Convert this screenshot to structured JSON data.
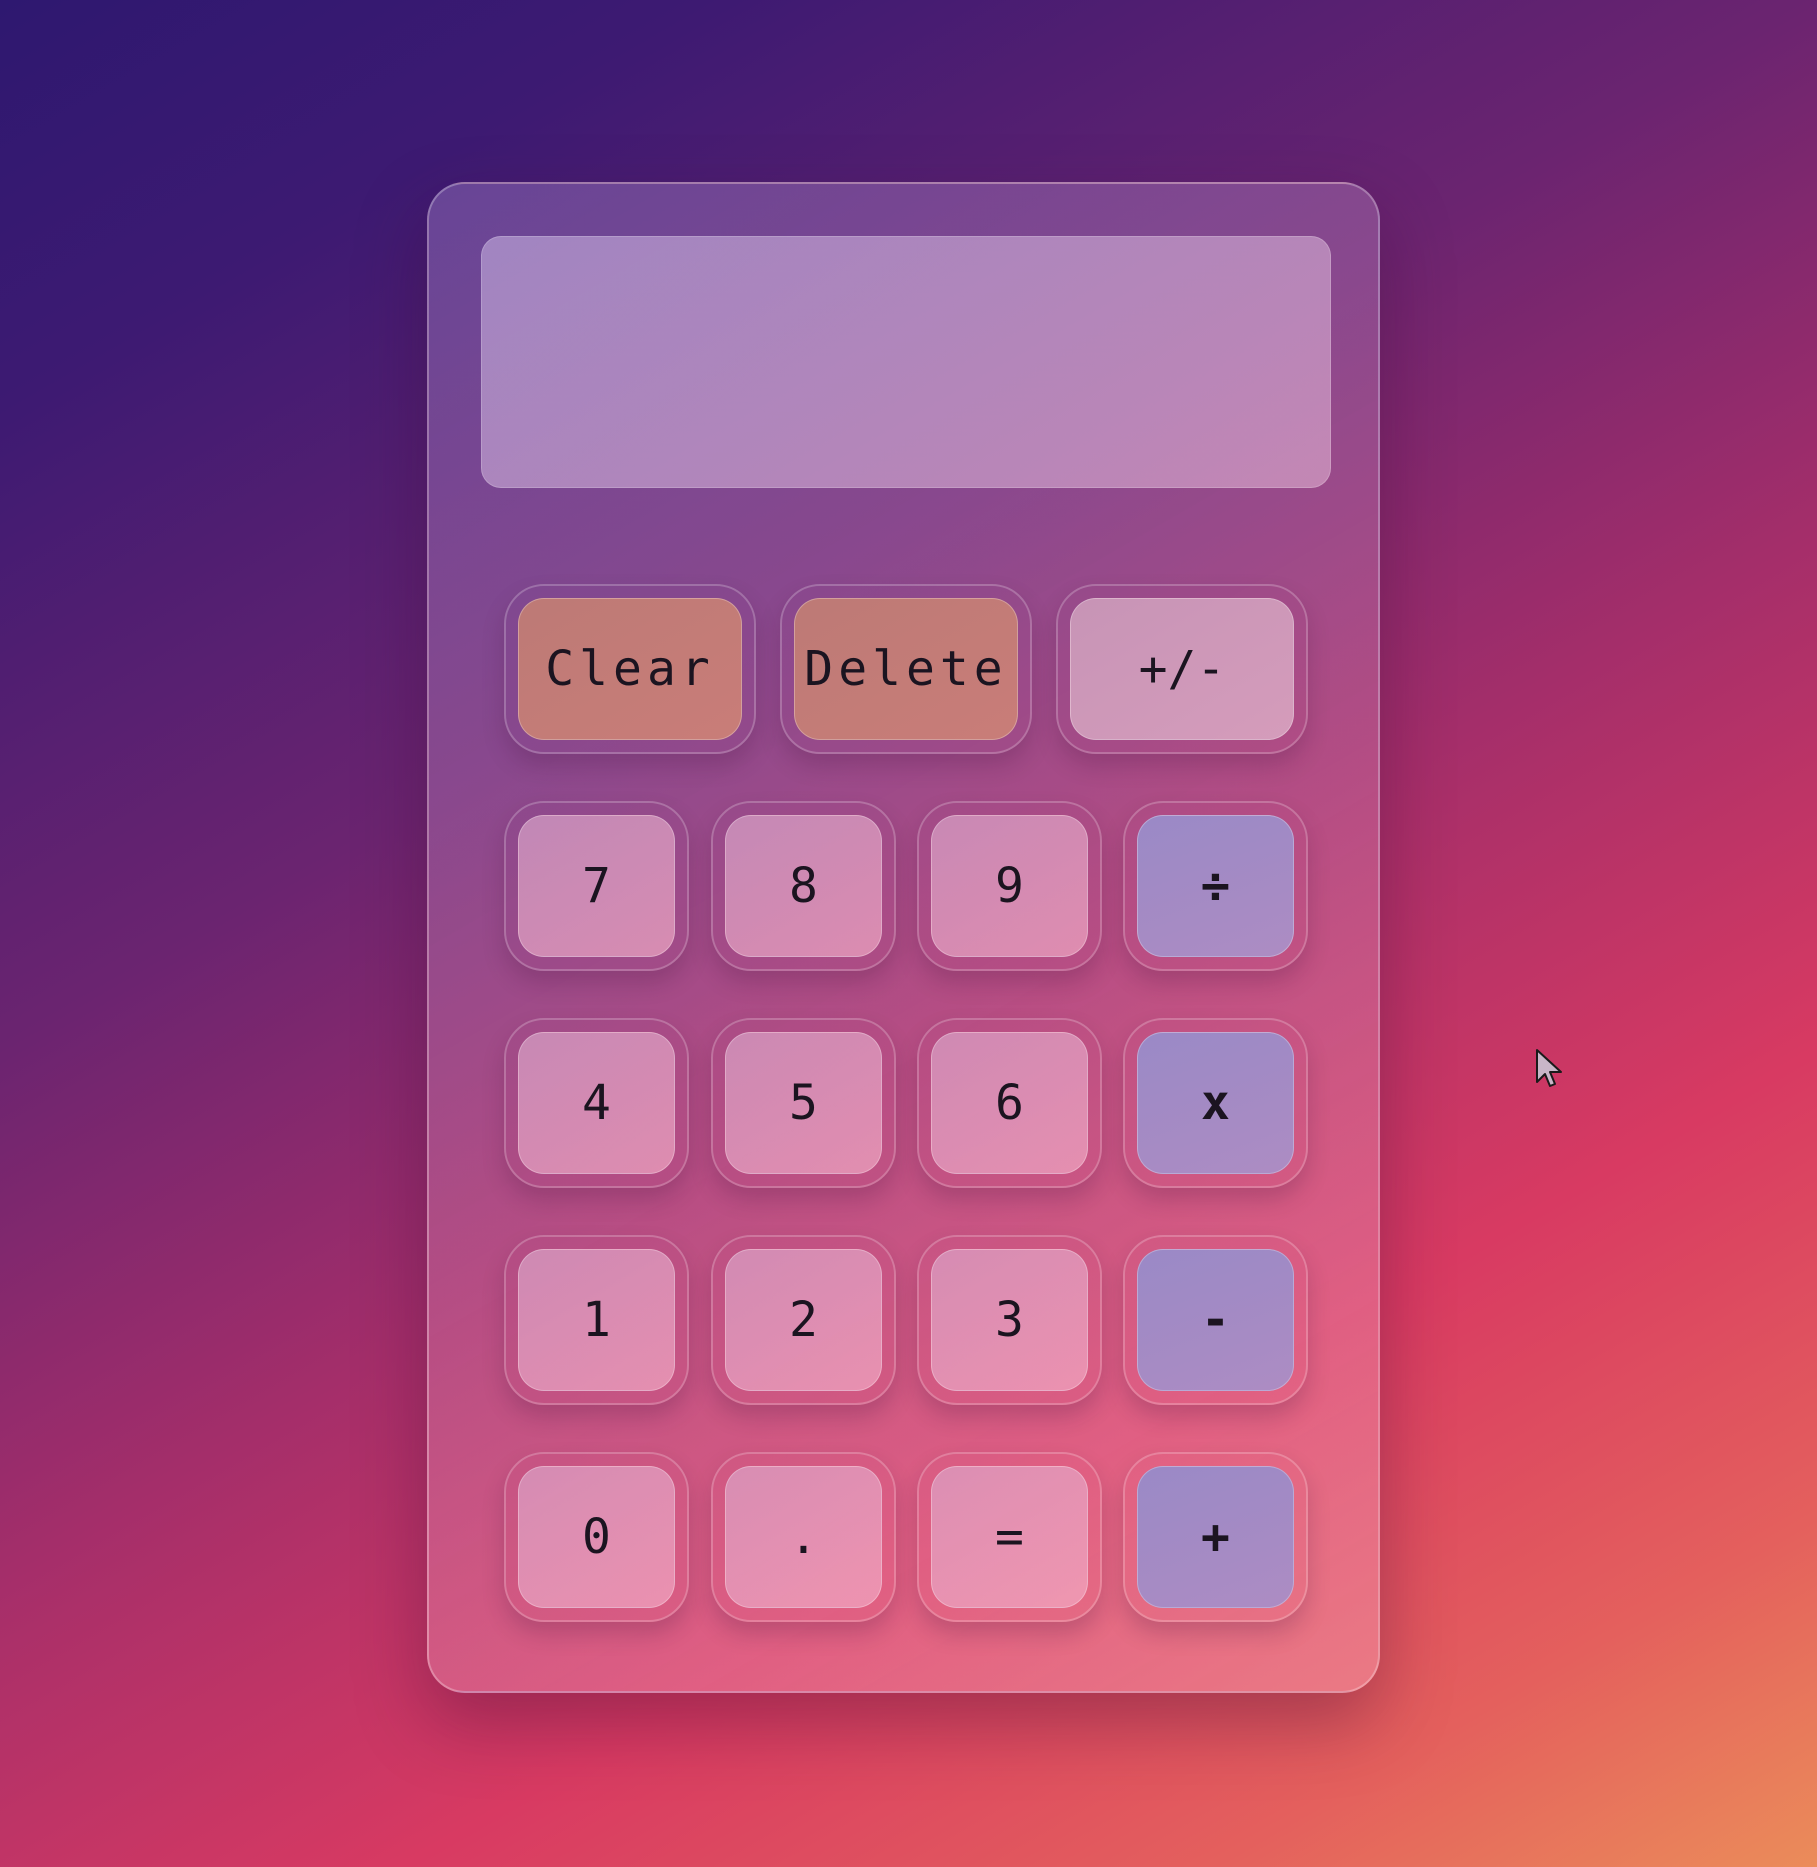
{
  "display": {
    "value": ""
  },
  "keys": {
    "clear": "Clear",
    "delete": "Delete",
    "sign": "+/-",
    "seven": "7",
    "eight": "8",
    "nine": "9",
    "divide": "÷",
    "four": "4",
    "five": "5",
    "six": "6",
    "multiply": "x",
    "one": "1",
    "two": "2",
    "three": "3",
    "subtract": "-",
    "zero": "0",
    "decimal": ".",
    "equals": "=",
    "add": "+"
  },
  "colors": {
    "background_start": "#2e1870",
    "background_end": "#eb8c5a",
    "clear_delete_key": "#c27c77",
    "sign_key": "#cf98b9",
    "operator_key": "#a38ac5",
    "number_key": "#e2a8c6"
  },
  "icons": {
    "pointer": "mouse-cursor-icon"
  }
}
